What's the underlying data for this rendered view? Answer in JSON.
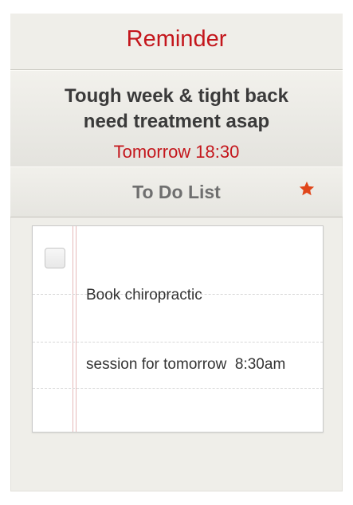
{
  "header": {
    "title": "Reminder"
  },
  "reminder": {
    "text_line1": "Tough week & tight back",
    "text_line2": "need treatment asap",
    "time": "Tomorrow 18:30"
  },
  "todo": {
    "title": "To Do List",
    "starred": true,
    "star_icon": "star-icon",
    "star_color": "#e0461a",
    "items": [
      {
        "line1": "Book chiropractic",
        "line2": "session for tomorrow  8:30am",
        "checked": false
      }
    ]
  },
  "colors": {
    "accent": "#c4161c",
    "background": "#efeee9"
  }
}
